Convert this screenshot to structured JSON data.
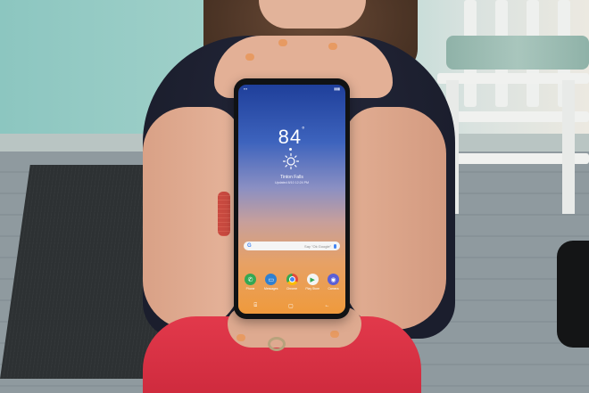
{
  "phone": {
    "weather": {
      "temperature": "84",
      "degree_symbol": "°",
      "location": "Tinton Falls",
      "updated": "Updated 8/10 12:24 PM"
    },
    "search": {
      "placeholder": "Say \"Ok Google\""
    },
    "apps": [
      {
        "label": "Phone",
        "icon": "phone-icon",
        "color": "#34a853"
      },
      {
        "label": "Messages",
        "icon": "messages-icon",
        "color": "#2f80d1"
      },
      {
        "label": "Chrome",
        "icon": "chrome-icon",
        "color": "#e4493b"
      },
      {
        "label": "Play Store",
        "icon": "play-store-icon",
        "color": "#f4f4f4"
      },
      {
        "label": "Camera",
        "icon": "camera-icon",
        "color": "#5b5fd6"
      }
    ]
  },
  "colors": {
    "shirt": "#1b1e2d",
    "pants": "#d9334a",
    "wall": "#9fd0c9"
  }
}
